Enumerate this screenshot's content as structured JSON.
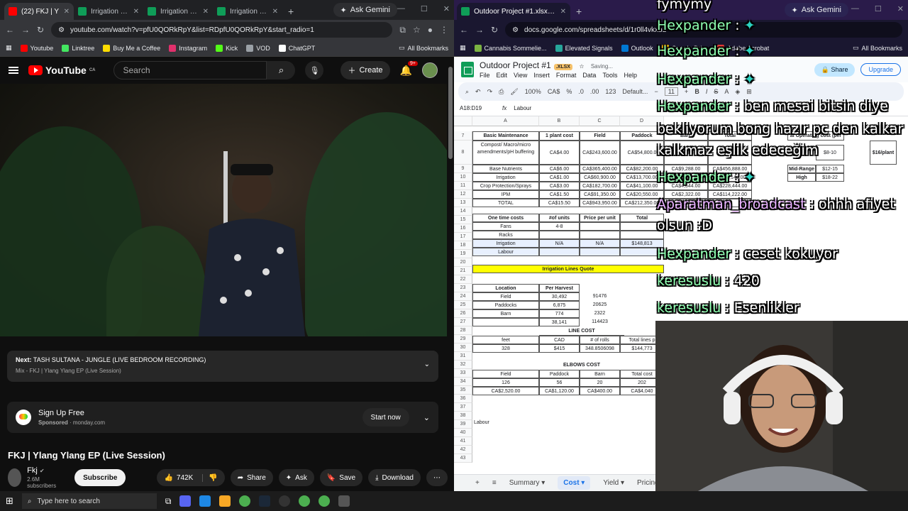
{
  "left_browser": {
    "tabs": [
      {
        "label": "(22) FKJ | Y",
        "active": true
      },
      {
        "label": "Irrigation Dire"
      },
      {
        "label": "Irrigation Dire"
      },
      {
        "label": "Irrigation Dire"
      }
    ],
    "ask_gemini": "Ask Gemini",
    "url": "youtube.com/watch?v=pfU0QORkRpY&list=RDpfU0QORkRpY&start_radio=1",
    "bookmarks": [
      "Youtube",
      "Linktree",
      "Buy Me a Coffee",
      "Instagram",
      "Kick",
      "VOD",
      "ChatGPT"
    ],
    "all_bookmarks": "All Bookmarks"
  },
  "youtube": {
    "logo": "YouTube",
    "region": "CA",
    "search_placeholder": "Search",
    "create": "Create",
    "notifications": "9+",
    "next_label": "Next:",
    "next_title": "TASH SULTANA - JUNGLE (LIVE BEDROOM RECORDING)",
    "mix_line": "Mix - FKJ  |  Ylang Ylang EP (Live Session)",
    "ad_title": "Sign Up Free",
    "ad_sponsored": "Sponsored",
    "ad_domain": "monday.com",
    "ad_button": "Start now",
    "video_title": "FKJ | Ylang Ylang EP (Live Session)",
    "channel": "Fkj",
    "subscribers": "2.6M subscribers",
    "subscribe": "Subscribe",
    "likes": "742K",
    "share": "Share",
    "ask": "Ask",
    "save": "Save",
    "download": "Download"
  },
  "right_browser": {
    "tabs": [
      {
        "label": "Outdoor Project #1.xlsx - Goog",
        "active": true
      }
    ],
    "ask_gemini": "Ask Gemini",
    "url": "docs.google.com/spreadsheets/d/1r0ll4vkxbL",
    "bookmarks": [
      "Cannabis Sommelie...",
      "Elevated Signals",
      "Outlook",
      "Google Drive",
      "Adobe Acrobat"
    ],
    "all_bookmarks": "All Bookmarks"
  },
  "sheet": {
    "doc_name": "Outdoor Project #1",
    "ext_badge": ".XLSX",
    "saving": "Saving...",
    "menu": [
      "File",
      "Edit",
      "View",
      "Insert",
      "Format",
      "Data",
      "Tools",
      "Help"
    ],
    "share": "Share",
    "upgrade": "Upgrade",
    "zoom": "100%",
    "currency": "CA$",
    "font": "Default...",
    "font_size": "11",
    "cell_ref": "A18:D19",
    "formula": "Labour",
    "columns": [
      "A",
      "B",
      "C",
      "D"
    ],
    "row_numbers": [
      "7",
      "8",
      "9",
      "10",
      "11",
      "12",
      "13",
      "14",
      "15",
      "16",
      "17",
      "18",
      "19",
      "20",
      "21",
      "22",
      "23",
      "24",
      "25",
      "26",
      "27",
      "28",
      "29",
      "30",
      "31",
      "32",
      "33",
      "34",
      "35",
      "36",
      "37",
      "38",
      "39",
      "40",
      "41",
      "42",
      "43"
    ],
    "maintenance": {
      "headers": [
        "Basic Maintenance",
        "1 plant cost",
        "Field",
        "Paddock",
        "Barn",
        "Total"
      ],
      "rows": [
        [
          "Compost/ Macro/micro amendments/pH buffering",
          "CA$4.00",
          "CA$243,600.00",
          "CA$54,800.0",
          "CA$9,288.00",
          ""
        ],
        [
          "Base Nutrients",
          "CA$6.00",
          "CA$365,400.00",
          "CA$82,200.00",
          "CA$9,288.00",
          "CA$456,888.00"
        ],
        [
          "Irrigation",
          "CA$1.00",
          "CA$60,900.00",
          "CA$13,700.00",
          "",
          "CA$76,148.00"
        ],
        [
          "Crop Protection/Sprays",
          "CA$3.00",
          "CA$182,700.00",
          "CA$41,100.00",
          "CA$4,644.00",
          "CA$228,444.00"
        ],
        [
          "IPM",
          "CA$1.50",
          "CA$91,350.00",
          "CA$20,550.00",
          "CA$2,322.00",
          "CA$114,222.00"
        ],
        [
          "TOTAL",
          "CA$15.50",
          "CA$943,950.00",
          "CA$212,350.00",
          "",
          ""
        ]
      ]
    },
    "side": {
      "header": "al Operating cost (per",
      "values": [
        "$8-10",
        "$16/plant",
        "Mid-Range",
        "$12-15",
        "High",
        "$18-22"
      ]
    },
    "one_time": {
      "headers": [
        "One time costs",
        "#of units",
        "Price per unit",
        "Total"
      ],
      "rows": [
        [
          "Fans",
          "4-8",
          "",
          ""
        ],
        [
          "Racks",
          "",
          "",
          ""
        ],
        [
          "Irrigation",
          "N/A",
          "N/A",
          "$148,813"
        ],
        [
          "Labour",
          "",
          "",
          ""
        ]
      ]
    },
    "irrigation_title": "Irrigation Lines Quote",
    "location": {
      "headers": [
        "Location",
        "Per Harvest"
      ],
      "rows": [
        [
          "Field",
          "30,492",
          "91476"
        ],
        [
          "Paddocks",
          "6,875",
          "20625"
        ],
        [
          "Barn",
          "774",
          "2322"
        ],
        [
          "",
          "38,141",
          "114423"
        ]
      ]
    },
    "line_cost": {
      "title": "LINE COST",
      "headers": [
        "feet",
        "CAD",
        "# of rolls",
        "Total lines p"
      ],
      "row": [
        "328",
        "$415",
        "348.8506098",
        "$144,773"
      ]
    },
    "elbows": {
      "title": "ELBOWS COST",
      "headers": [
        "Field",
        "Paddock",
        "Barn",
        "Total cost"
      ],
      "rows": [
        [
          "126",
          "56",
          "20",
          "202"
        ],
        [
          "CA$2,520.00",
          "CA$1,120.00",
          "CA$400.00",
          "CA$4,040"
        ]
      ]
    },
    "labour_cell": "Labour",
    "sheet_tabs": [
      "Summary",
      "Cost",
      "Yield",
      "Pricing"
    ]
  },
  "chat": [
    {
      "name": "",
      "text": "fymymy"
    },
    {
      "name": "Hexpander",
      "text": ""
    },
    {
      "name": "Hexpander",
      "text": ""
    },
    {
      "name": "Hexpander",
      "text": ""
    },
    {
      "name": "Hexpander",
      "text": "ben mesai bitsin diye"
    },
    {
      "name": "",
      "text": "bekliyorum bong hazır pc den kalkar"
    },
    {
      "name": "",
      "text": "kalkmaz eşlik edeceğim"
    },
    {
      "name": "Hexpander",
      "text": ""
    },
    {
      "name": "Aparatman_broadcast",
      "text": "ohhh afiyet"
    },
    {
      "name": "",
      "text": "olsun :D"
    },
    {
      "name": "Hexpander",
      "text": "ceset kokuyor"
    },
    {
      "name": "keresuslu",
      "text": "420"
    },
    {
      "name": "keresuslu",
      "text": "Esenlikler"
    }
  ],
  "taskbar": {
    "search_placeholder": "Type here to search"
  },
  "colors": {
    "youtube_red": "#ff0000",
    "sheets_green": "#0f9d58",
    "highlight_yellow": "#ffff00",
    "chat_name": "#8effb0"
  }
}
